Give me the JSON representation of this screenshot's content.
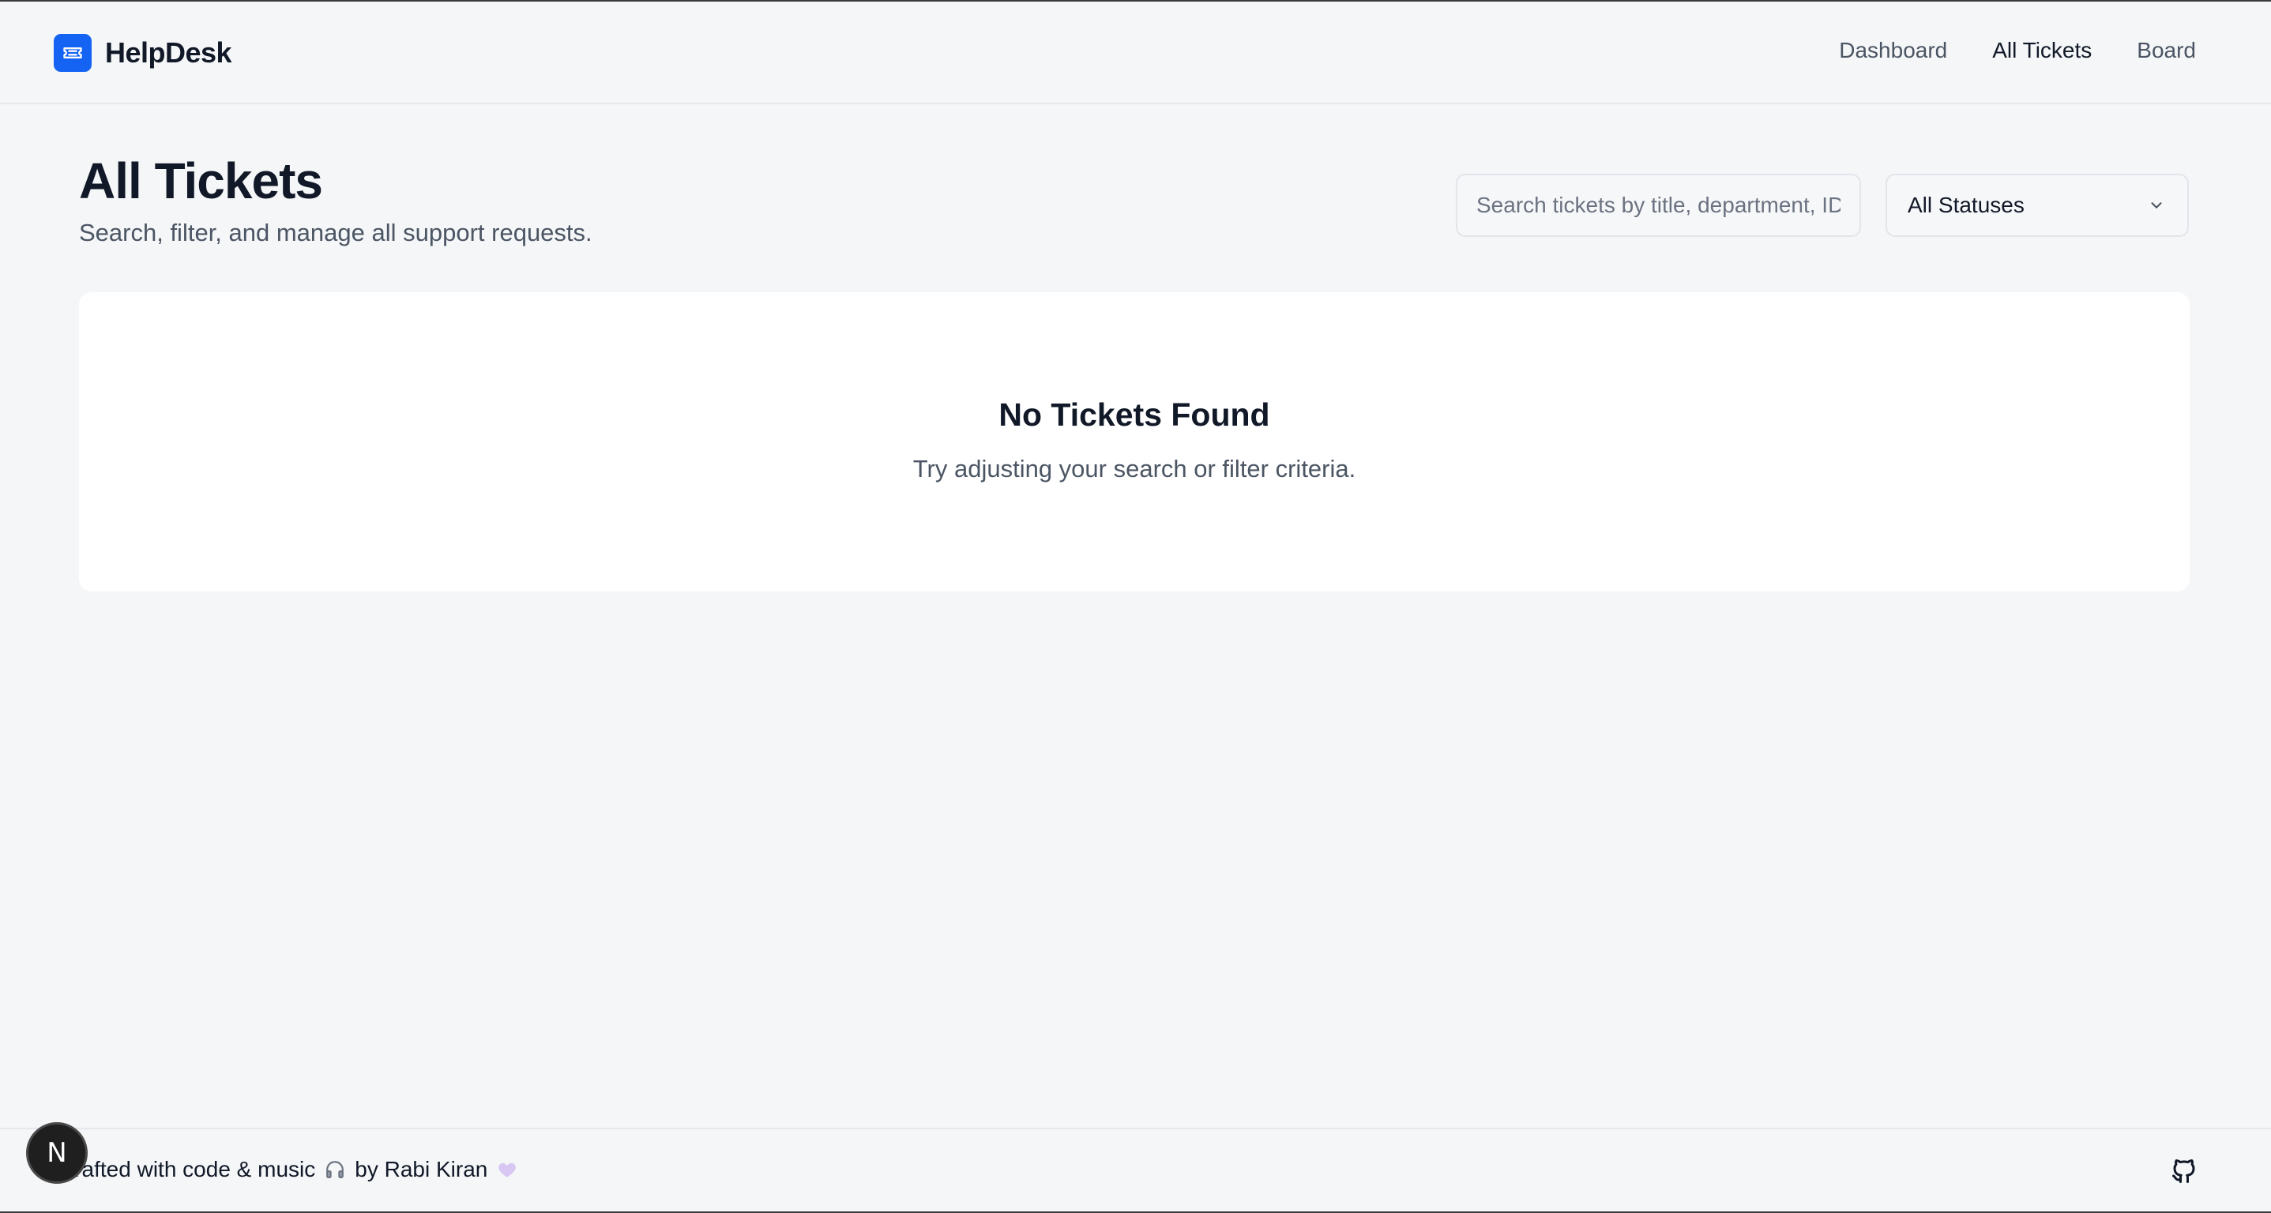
{
  "header": {
    "brand": "HelpDesk",
    "nav": [
      "Dashboard",
      "All Tickets",
      "Board"
    ],
    "active_nav": "All Tickets"
  },
  "page": {
    "title": "All Tickets",
    "subtitle": "Search, filter, and manage all support requests."
  },
  "controls": {
    "search_placeholder": "Search tickets by title, department, ID...",
    "status_value": "All Statuses"
  },
  "empty_state": {
    "title": "No Tickets Found",
    "text": "Try adjusting your search or filter criteria."
  },
  "footer": {
    "text_start": "Crafted with code & music",
    "text_mid": "by Rabi Kiran"
  },
  "dev_badge": "N",
  "colors": {
    "accent": "#1463f3",
    "background": "#f4f6f8",
    "card": "#ffffff"
  },
  "icons": {
    "logo": "ticket-icon",
    "select": "chevron-down-icon",
    "footer_music": "headphones-icon",
    "footer_heart": "heart-icon",
    "footer_link": "github-icon"
  }
}
